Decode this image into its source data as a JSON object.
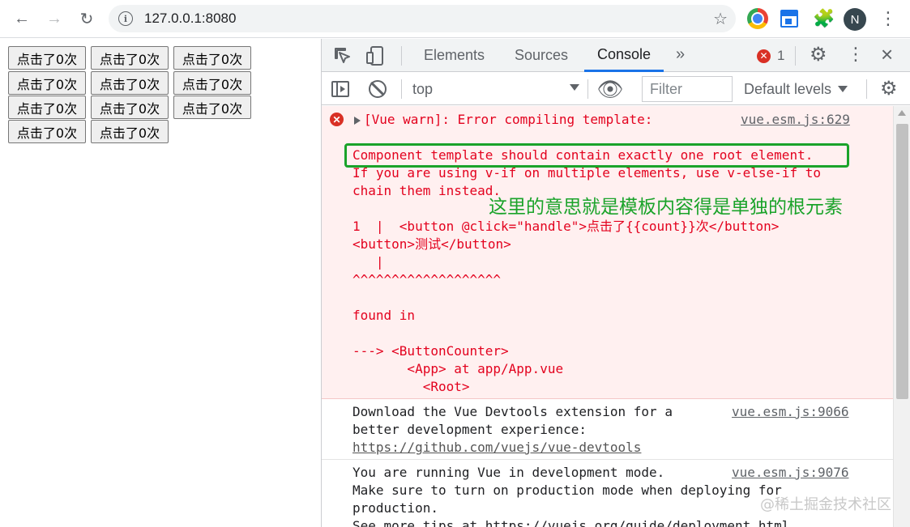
{
  "browser": {
    "url": "127.0.0.1:8080",
    "avatar_letter": "N"
  },
  "page": {
    "buttons": [
      "点击了0次",
      "点击了0次",
      "点击了0次",
      "点击了0次",
      "点击了0次",
      "点击了0次",
      "点击了0次",
      "点击了0次",
      "点击了0次",
      "点击了0次",
      "点击了0次"
    ]
  },
  "devtools": {
    "tabs": {
      "elements": "Elements",
      "sources": "Sources",
      "console": "Console",
      "more": "»"
    },
    "error_count": "1",
    "toolbar": {
      "context": "top",
      "filter_placeholder": "Filter",
      "levels": "Default levels"
    },
    "error_message": {
      "title": "[Vue warn]: Error compiling template:",
      "source": "vue.esm.js:629",
      "l1": "Component template should contain exactly one root element.",
      "l2": "If you are using v-if on multiple elements, use v-else-if to",
      "l3": "chain them instead.",
      "annotation": "这里的意思就是模板内容得是单独的根元素",
      "code1_pre": "1  |  <button @click=\"handle\">",
      "code1_cjk": "点击了",
      "code1_mid": "{{count}}",
      "code1_cjk2": "次",
      "code1_end": "</button>",
      "code2_pre": "<button>",
      "code2_cjk": "测试",
      "code2_end": "</button>",
      "code3": "   |",
      "code4": "^^^^^^^^^^^^^^^^^^^",
      "found": "found in",
      "trace1": "---> <ButtonCounter>",
      "trace2": "       <App> at app/App.vue",
      "trace3": "         <Root>"
    },
    "info1": {
      "l1": "Download the Vue Devtools extension for a",
      "l2": "better development experience:",
      "link": "https://github.com/vuejs/vue-devtools",
      "source": "vue.esm.js:9066"
    },
    "info2": {
      "l1": "You are running Vue in development mode.",
      "l2": "Make sure to turn on production mode when deploying for",
      "l3": "production.",
      "l4": "See more tips at https://vuejs.org/guide/deployment.html",
      "source": "vue.esm.js:9076"
    }
  },
  "watermark": "@稀土掘金技术社区"
}
